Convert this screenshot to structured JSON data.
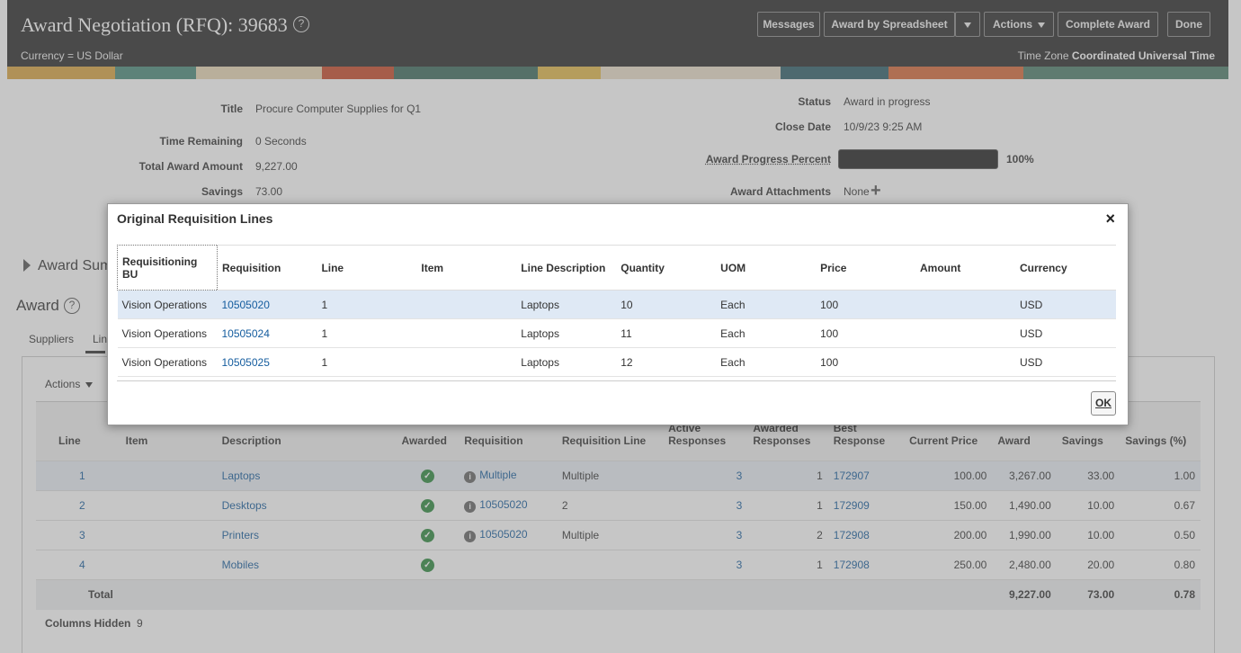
{
  "header": {
    "title": "Award Negotiation (RFQ): 39683",
    "currency": "Currency = US Dollar",
    "timezone_label": "Time Zone",
    "timezone_value": "Coordinated Universal Time",
    "buttons": {
      "messages": "Messages",
      "award_by_spreadsheet": "Award by Spreadsheet",
      "actions": "Actions",
      "complete_award": "Complete Award",
      "done": "Done"
    }
  },
  "summary": {
    "title_label": "Title",
    "title_value": "Procure Computer Supplies for Q1",
    "time_remaining_label": "Time Remaining",
    "time_remaining_value": "0 Seconds",
    "total_award_label": "Total Award Amount",
    "total_award_value": "9,227.00",
    "savings_label": "Savings",
    "savings_value": "73.00",
    "status_label": "Status",
    "status_value": "Award in progress",
    "close_date_label": "Close Date",
    "close_date_value": "10/9/23 9:25 AM",
    "progress_label": "Award Progress Percent",
    "progress_value": "100%",
    "progress_fraction": 1.0,
    "attachments_label": "Award Attachments",
    "attachments_value": "None"
  },
  "background": {
    "award_summary": "Award Sum",
    "award_heading": "Award",
    "tabs": [
      "Suppliers",
      "Lin"
    ],
    "actions": "Actions",
    "columns_hidden_label": "Columns Hidden",
    "columns_hidden_value": "9",
    "columns": {
      "line": "Line",
      "item": "Item",
      "description": "Description",
      "awarded": "Awarded",
      "requisition": "Requisition",
      "requisition_line": "Requisition Line",
      "active_responses": "Active Responses",
      "awarded_responses": "Awarded Responses",
      "best_response": "Best Response",
      "current_price": "Current Price",
      "award": "Award",
      "savings": "Savings",
      "savings_pct": "Savings (%)"
    },
    "rows": [
      {
        "line": "1",
        "description": "Laptops",
        "requisition": "Multiple",
        "req_line": "Multiple",
        "active": "3",
        "awarded": "1",
        "best": "172907",
        "price": "100.00",
        "award": "3,267.00",
        "savings": "33.00",
        "pct": "1.00"
      },
      {
        "line": "2",
        "description": "Desktops",
        "requisition": "10505020",
        "req_line": "2",
        "active": "3",
        "awarded": "1",
        "best": "172909",
        "price": "150.00",
        "award": "1,490.00",
        "savings": "10.00",
        "pct": "0.67"
      },
      {
        "line": "3",
        "description": "Printers",
        "requisition": "10505020",
        "req_line": "Multiple",
        "active": "3",
        "awarded": "2",
        "best": "172908",
        "price": "200.00",
        "award": "1,990.00",
        "savings": "10.00",
        "pct": "0.50"
      },
      {
        "line": "4",
        "description": "Mobiles",
        "requisition": "",
        "req_line": "",
        "active": "3",
        "awarded": "1",
        "best": "172908",
        "price": "250.00",
        "award": "2,480.00",
        "savings": "20.00",
        "pct": "0.80"
      }
    ],
    "total": {
      "label": "Total",
      "award": "9,227.00",
      "savings": "73.00",
      "pct": "0.78"
    }
  },
  "dialog": {
    "title": "Original Requisition Lines",
    "close": "×",
    "ok": "OK",
    "columns": {
      "bu": "Requisitioning BU",
      "requisition": "Requisition",
      "line": "Line",
      "item": "Item",
      "line_description": "Line Description",
      "quantity": "Quantity",
      "uom": "UOM",
      "price": "Price",
      "amount": "Amount",
      "currency": "Currency"
    },
    "rows": [
      {
        "bu": "Vision Operations",
        "requisition": "10505020",
        "line": "1",
        "item": "",
        "line_description": "Laptops",
        "quantity": "10",
        "uom": "Each",
        "price": "100",
        "amount": "",
        "currency": "USD"
      },
      {
        "bu": "Vision Operations",
        "requisition": "10505024",
        "line": "1",
        "item": "",
        "line_description": "Laptops",
        "quantity": "11",
        "uom": "Each",
        "price": "100",
        "amount": "",
        "currency": "USD"
      },
      {
        "bu": "Vision Operations",
        "requisition": "10505025",
        "line": "1",
        "item": "",
        "line_description": "Laptops",
        "quantity": "12",
        "uom": "Each",
        "price": "100",
        "amount": "",
        "currency": "USD"
      }
    ]
  },
  "colors": {
    "header_bg": "#2a2a2a",
    "link": "#145c9e",
    "awarded_check": "#2e8b3e",
    "selected_row": "#dfe9f5"
  }
}
